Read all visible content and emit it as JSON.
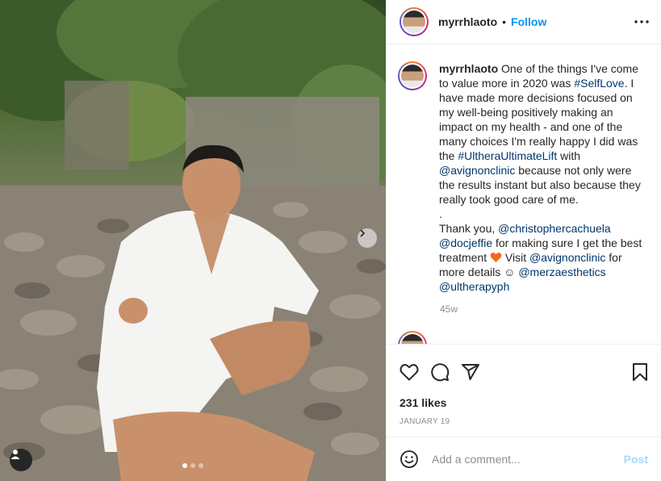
{
  "post": {
    "username": "myrrhlaoto",
    "separator": "•",
    "follow_label": "Follow",
    "photo_alt": "Man in white bathrobe sitting on beach pebbles",
    "carousel": {
      "count": 3,
      "active_index": 0
    }
  },
  "caption": {
    "username": "myrrhlaoto",
    "p1": " One of the things I've come to value more in 2020 was ",
    "tag_selflove": "#SelfLove",
    "p2": ". I have made more decisions focused on my well-being positively making an impact on my health - and one of the many choices I'm really happy I did was the ",
    "tag_ulthera": "#UltheraUltimateLift",
    "p3": " with ",
    "mention_avignon": "@avignonclinic",
    "p4": " because not only were the results instant but also because they really took good care of me.\n.\nThank you, ",
    "mention_christopher": "@christophercachuela",
    "p5": "\n",
    "mention_docjeffie": "@docjeffie",
    "p6": " for making sure I get the best treatment ",
    "p7": " Visit ",
    "mention_avignon2": "@avignonclinic",
    "p8": " for more details ☺ ",
    "mention_merza": "@merzaesthetics",
    "p9": "\n",
    "mention_ultherapy": "@ultherapyph",
    "time": "45w"
  },
  "next_comment": {
    "text": ""
  },
  "actions": {
    "likes": "231 likes",
    "date": "JANUARY 19"
  },
  "comment_box": {
    "placeholder": "Add a comment...",
    "post_label": "Post"
  },
  "colors": {
    "link": "#00376b",
    "follow": "#0095f6",
    "muted": "#8e8e8e",
    "heart": "#f26a1b"
  },
  "icons": [
    "more-icon",
    "heart-icon",
    "comment-icon",
    "share-icon",
    "save-icon",
    "emoji-icon",
    "chevron-right-icon",
    "user-tag-icon"
  ]
}
